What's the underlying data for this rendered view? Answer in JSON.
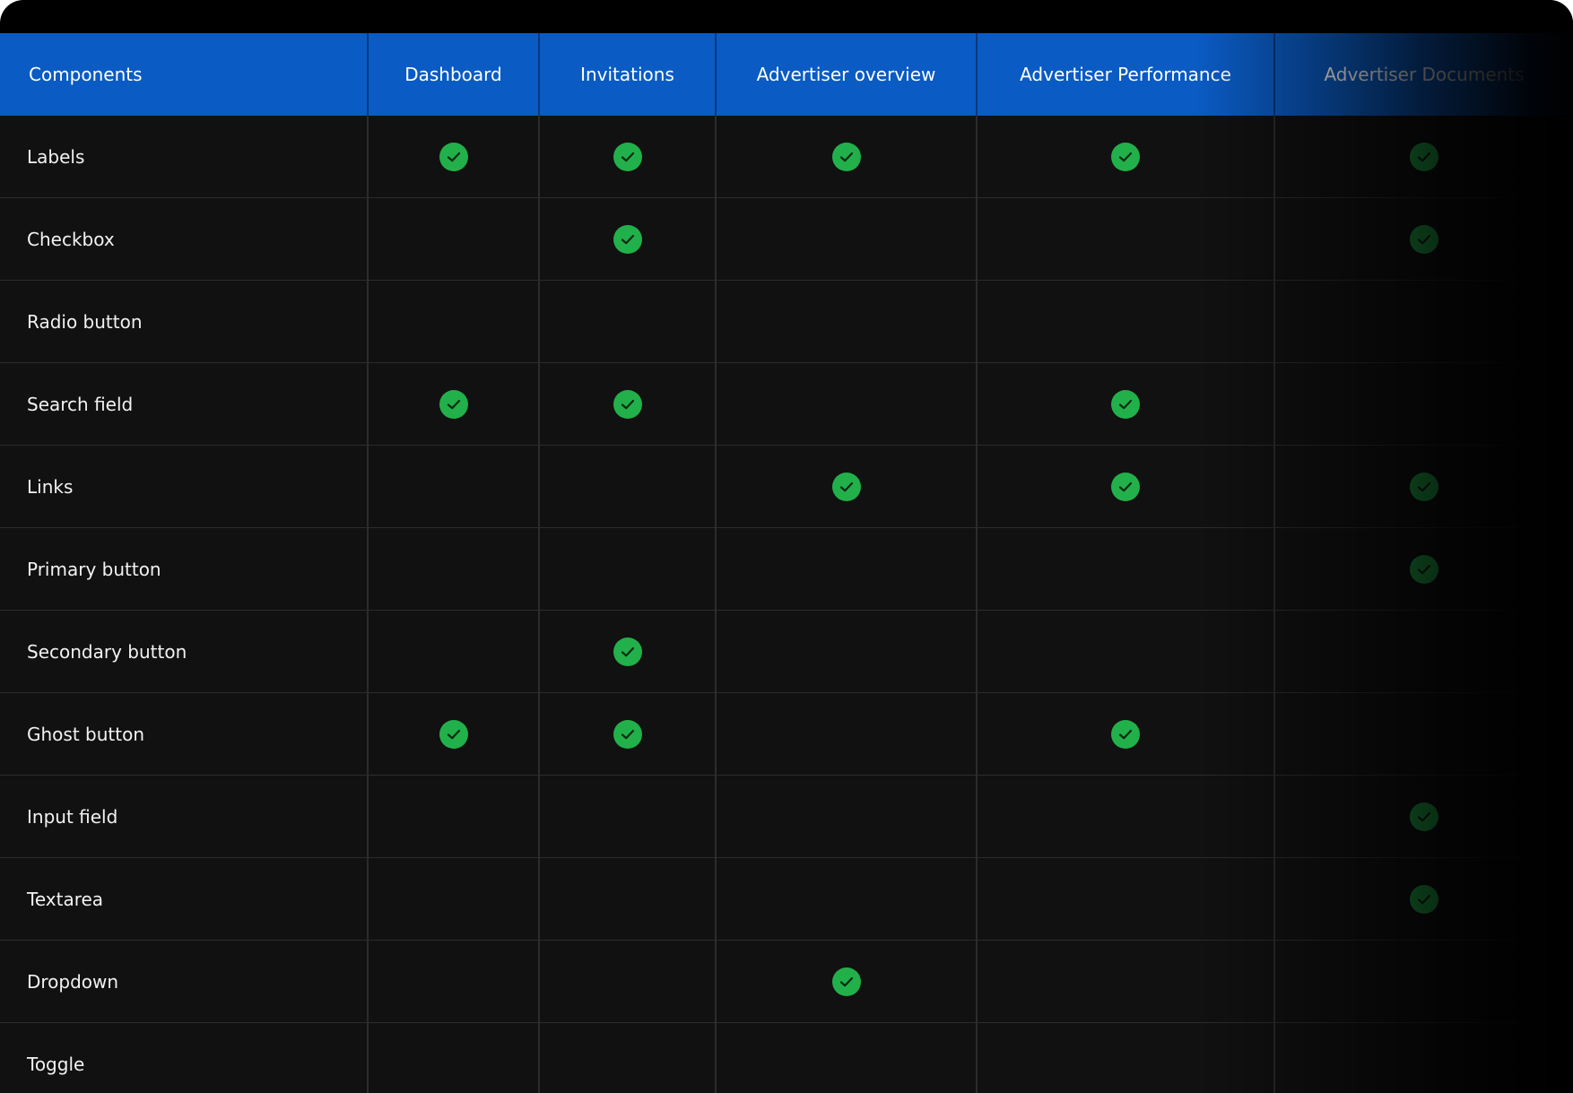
{
  "colors": {
    "header_bg": "#0a5bc4",
    "row_bg": "#111111",
    "grid_line": "#2c2c2c",
    "check_green": "#22b04b",
    "frame": "#000000"
  },
  "table": {
    "headers": [
      "Components",
      "Dashboard",
      "Invitations",
      "Advertiser overview",
      "Advertiser Performance",
      "Advertiser Documents"
    ],
    "rows": [
      {
        "label": "Labels",
        "checks": [
          true,
          true,
          true,
          true,
          true
        ]
      },
      {
        "label": "Checkbox",
        "checks": [
          false,
          true,
          false,
          false,
          true
        ]
      },
      {
        "label": "Radio button",
        "checks": [
          false,
          false,
          false,
          false,
          false
        ]
      },
      {
        "label": "Search field",
        "checks": [
          true,
          true,
          false,
          true,
          false
        ]
      },
      {
        "label": "Links",
        "checks": [
          false,
          false,
          true,
          true,
          true
        ]
      },
      {
        "label": "Primary button",
        "checks": [
          false,
          false,
          false,
          false,
          true
        ]
      },
      {
        "label": "Secondary button",
        "checks": [
          false,
          true,
          false,
          false,
          false
        ]
      },
      {
        "label": "Ghost button",
        "checks": [
          true,
          true,
          false,
          true,
          false
        ]
      },
      {
        "label": "Input field",
        "checks": [
          false,
          false,
          false,
          false,
          true
        ]
      },
      {
        "label": "Textarea",
        "checks": [
          false,
          false,
          false,
          false,
          true
        ]
      },
      {
        "label": "Dropdown",
        "checks": [
          false,
          false,
          true,
          false,
          false
        ]
      },
      {
        "label": "Toggle",
        "checks": [
          false,
          false,
          false,
          false,
          false
        ]
      }
    ],
    "check_icon": "check-circle-icon"
  }
}
